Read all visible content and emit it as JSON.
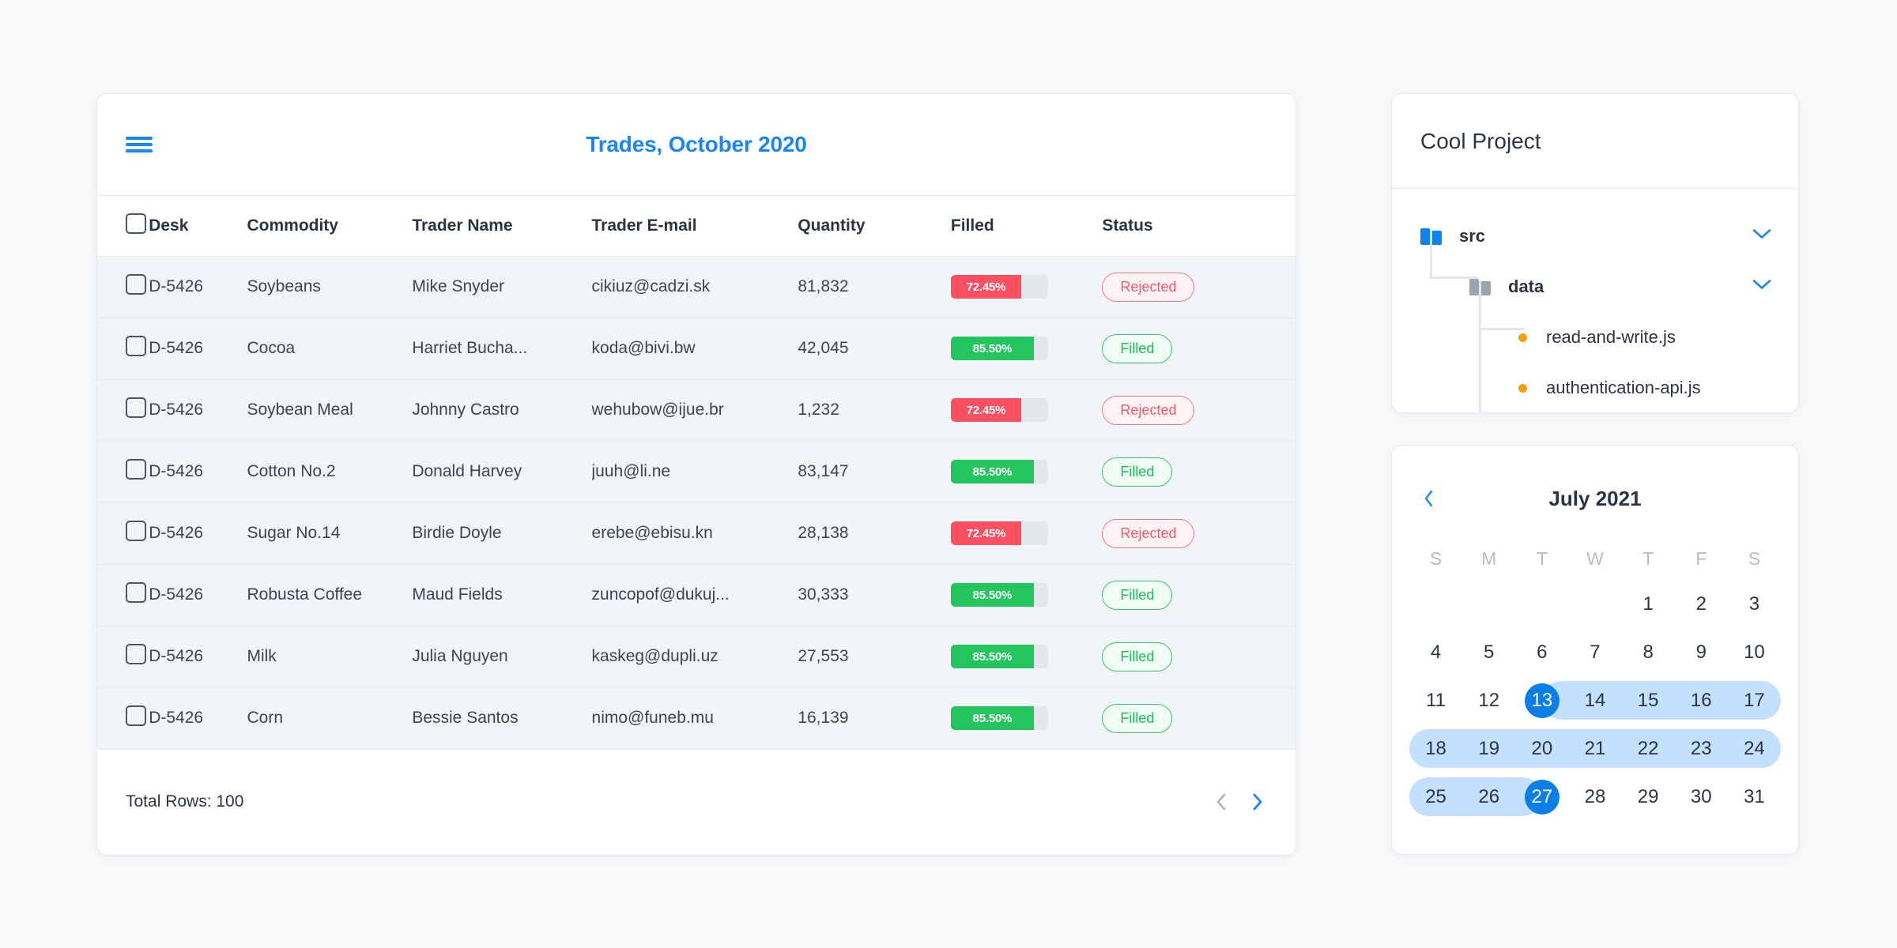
{
  "colors": {
    "accent_blue": "#1a85fb",
    "selected_blue": "#0c7fe6",
    "range_blue": "#c3e0fd",
    "red": "#fa5062",
    "green": "#22c55e",
    "page_bg": "#f6f8fa",
    "row_bg": "#f2f5f8"
  },
  "trades": {
    "title": "Trades, October 2020",
    "menu_icon": "hamburger-menu-icon",
    "columns": [
      {
        "key": "check",
        "label": ""
      },
      {
        "key": "desk",
        "label": "Desk"
      },
      {
        "key": "commodity",
        "label": "Commodity"
      },
      {
        "key": "trader",
        "label": "Trader Name"
      },
      {
        "key": "email",
        "label": "Trader E-mail"
      },
      {
        "key": "quantity",
        "label": "Quantity"
      },
      {
        "key": "filled",
        "label": "Filled"
      },
      {
        "key": "status",
        "label": "Status"
      }
    ],
    "rows": [
      {
        "desk": "D-5426",
        "commodity": "Soybeans",
        "trader": "Mike Snyder",
        "email": "cikiuz@cadzi.sk",
        "quantity": "81,832",
        "filled_label": "72.45%",
        "filled_value": 72.45,
        "status": "Rejected",
        "status_kind": "rejected"
      },
      {
        "desk": "D-5426",
        "commodity": "Cocoa",
        "trader": "Harriet Bucha...",
        "email": "koda@bivi.bw",
        "quantity": "42,045",
        "filled_label": "85.50%",
        "filled_value": 85.5,
        "status": "Filled",
        "status_kind": "filled"
      },
      {
        "desk": "D-5426",
        "commodity": "Soybean Meal",
        "trader": "Johnny Castro",
        "email": "wehubow@ijue.br",
        "quantity": "1,232",
        "filled_label": "72.45%",
        "filled_value": 72.45,
        "status": "Rejected",
        "status_kind": "rejected"
      },
      {
        "desk": "D-5426",
        "commodity": "Cotton No.2",
        "trader": "Donald Harvey",
        "email": "juuh@li.ne",
        "quantity": "83,147",
        "filled_label": "85.50%",
        "filled_value": 85.5,
        "status": "Filled",
        "status_kind": "filled"
      },
      {
        "desk": "D-5426",
        "commodity": "Sugar No.14",
        "trader": "Birdie Doyle",
        "email": "erebe@ebisu.kn",
        "quantity": "28,138",
        "filled_label": "72.45%",
        "filled_value": 72.45,
        "status": "Rejected",
        "status_kind": "rejected"
      },
      {
        "desk": "D-5426",
        "commodity": "Robusta Coffee",
        "trader": "Maud Fields",
        "email": "zuncopof@dukuj...",
        "quantity": "30,333",
        "filled_label": "85.50%",
        "filled_value": 85.5,
        "status": "Filled",
        "status_kind": "filled"
      },
      {
        "desk": "D-5426",
        "commodity": "Milk",
        "trader": "Julia Nguyen",
        "email": "kaskeg@dupli.uz",
        "quantity": "27,553",
        "filled_label": "85.50%",
        "filled_value": 85.5,
        "status": "Filled",
        "status_kind": "filled"
      },
      {
        "desk": "D-5426",
        "commodity": "Corn",
        "trader": "Bessie Santos",
        "email": "nimo@funeb.mu",
        "quantity": "16,139",
        "filled_label": "85.50%",
        "filled_value": 85.5,
        "status": "Filled",
        "status_kind": "filled"
      }
    ],
    "footer": {
      "total_rows": "Total Rows: 100",
      "prev_icon": "chevron-left-icon",
      "next_icon": "chevron-right-icon",
      "prev_enabled": false,
      "next_enabled": true
    }
  },
  "project": {
    "title": "Cool Project",
    "tree": [
      {
        "name": "src",
        "type": "folder",
        "icon": "folder-icon-blue",
        "depth": 0,
        "expanded": true,
        "chevron": "chevron-down-icon"
      },
      {
        "name": "data",
        "type": "folder",
        "icon": "folder-icon-gray",
        "depth": 1,
        "expanded": true,
        "chevron": "chevron-down-icon"
      },
      {
        "name": "read-and-write.js",
        "type": "file",
        "icon": "dot-icon-orange",
        "depth": 2
      },
      {
        "name": "authentication-api.js",
        "type": "file",
        "icon": "dot-icon-orange",
        "depth": 2
      }
    ]
  },
  "calendar": {
    "month_label": "July 2021",
    "prev_icon": "chevron-left-icon",
    "weekdays": [
      "S",
      "M",
      "T",
      "W",
      "T",
      "F",
      "S"
    ],
    "lead_blanks": 4,
    "days": [
      1,
      2,
      3,
      4,
      5,
      6,
      7,
      8,
      9,
      10,
      11,
      12,
      13,
      14,
      15,
      16,
      17,
      18,
      19,
      20,
      21,
      22,
      23,
      24,
      25,
      26,
      27,
      28,
      29,
      30,
      31
    ],
    "range_start": 13,
    "range_end": 27,
    "selected": [
      13,
      27
    ]
  }
}
